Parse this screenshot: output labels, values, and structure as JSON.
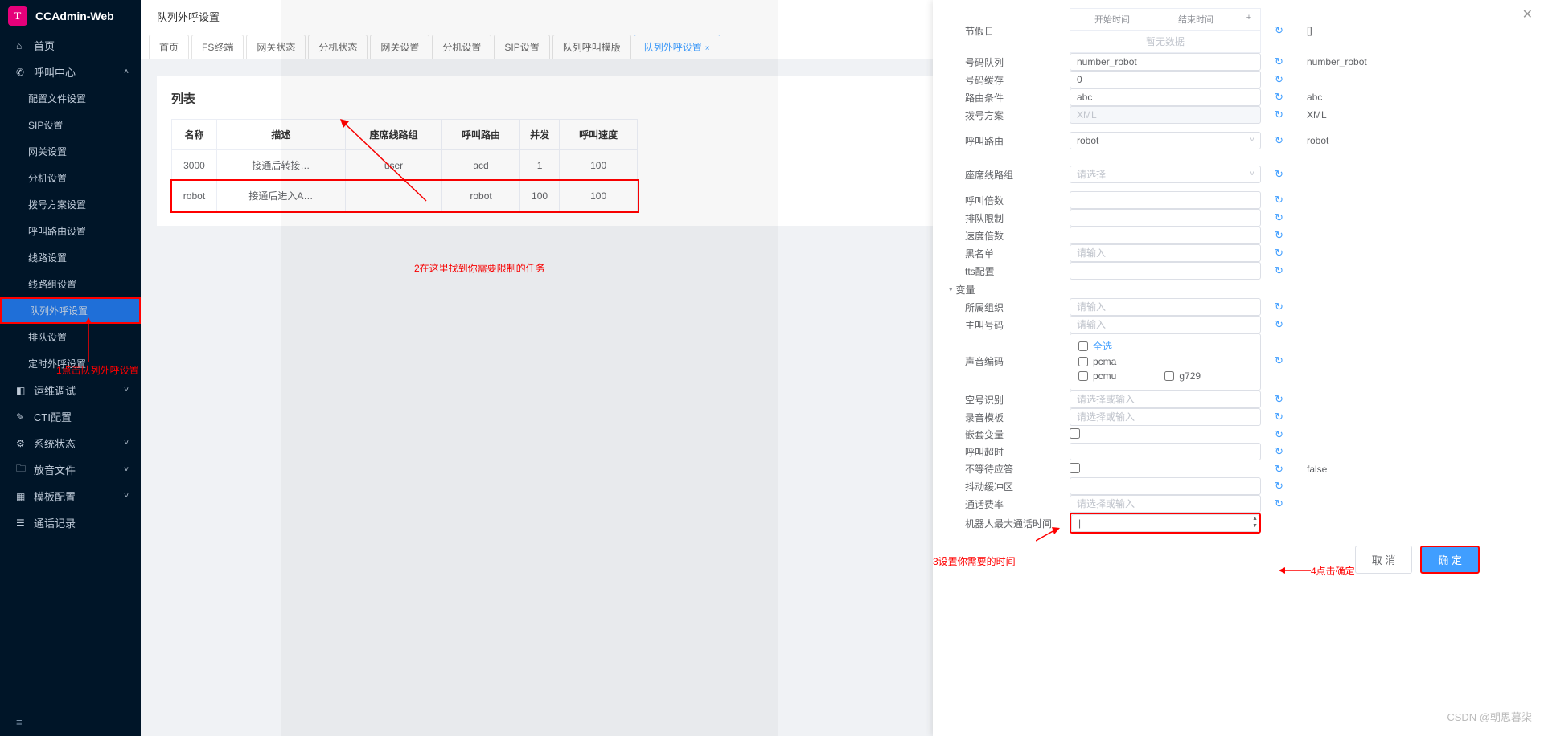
{
  "brand": {
    "logo_text": "T",
    "title": "CCAdmin-Web"
  },
  "sidebar": {
    "home": "首页",
    "call_center": "呼叫中心",
    "items": [
      "配置文件设置",
      "SIP设置",
      "网关设置",
      "分机设置",
      "拨号方案设置",
      "呼叫路由设置",
      "线路设置",
      "线路组设置",
      "队列外呼设置",
      "排队设置",
      "定时外呼设置"
    ],
    "ops": "运维调试",
    "cti": "CTI配置",
    "sys": "系统状态",
    "play": "放音文件",
    "tpl": "模板配置",
    "cdr": "通话记录"
  },
  "breadcrumb": "队列外呼设置",
  "tabs": [
    "首页",
    "FS终端",
    "网关状态",
    "分机状态",
    "网关设置",
    "分机设置",
    "SIP设置",
    "队列呼叫模版",
    "队列外呼设置"
  ],
  "list": {
    "title": "列表",
    "headers": [
      "名称",
      "描述",
      "座席线路组",
      "呼叫路由",
      "并发",
      "呼叫速度"
    ],
    "rows": [
      [
        "3000",
        "接通后转接…",
        "user",
        "acd",
        "1",
        "100"
      ],
      [
        "robot",
        "接通后进入A…",
        "",
        "robot",
        "100",
        "100"
      ]
    ]
  },
  "drawer": {
    "labels": {
      "holiday": "节假日",
      "num_queue": "号码队列",
      "num_cache": "号码缓存",
      "route_cond": "路由条件",
      "dial_plan": "拨号方案",
      "call_route": "呼叫路由",
      "agent_group": "座席线路组",
      "call_multi": "呼叫倍数",
      "queue_limit": "排队限制",
      "speed_multi": "速度倍数",
      "blacklist": "黑名单",
      "tts": "tts配置",
      "vars": "变量",
      "org": "所属组织",
      "caller": "主叫号码",
      "codec": "声音编码",
      "empty_detect": "空号识别",
      "rec_tpl": "录音模板",
      "nest_var": "嵌套变量",
      "call_timeout": "呼叫超时",
      "no_wait": "不等待应答",
      "jitter": "抖动缓冲区",
      "call_rate": "通话费率",
      "max_talk": "机器人最大通话时间"
    },
    "values": {
      "num_queue": "number_robot",
      "num_cache": "0",
      "route_cond": "abc",
      "dial_plan": "XML",
      "call_route": "robot"
    },
    "readonly": {
      "holiday": "[]",
      "num_queue": "number_robot",
      "route_cond": "abc",
      "dial_plan": "XML",
      "call_route": "robot",
      "no_wait": "false"
    },
    "placeholders": {
      "agent_group": "请选择",
      "blacklist": "请输入",
      "org": "请输入",
      "caller": "请输入",
      "empty_detect": "请选择或输入",
      "rec_tpl": "请选择或输入",
      "call_rate": "请选择或输入"
    },
    "time_table": {
      "start": "开始时间",
      "end": "结束时间",
      "add": "+",
      "empty": "暂无数据"
    },
    "codec": {
      "all": "全选",
      "pcma": "pcma",
      "pcmu": "pcmu",
      "g729": "g729"
    },
    "buttons": {
      "cancel": "取 消",
      "ok": "确 定"
    }
  },
  "annotations": {
    "a1": "1点击队列外呼设置",
    "a2": "2在这里找到你需要限制的任务",
    "a3": "3设置你需要的时间",
    "a4": "4点击确定"
  },
  "watermark": "CSDN @朝思暮柒"
}
